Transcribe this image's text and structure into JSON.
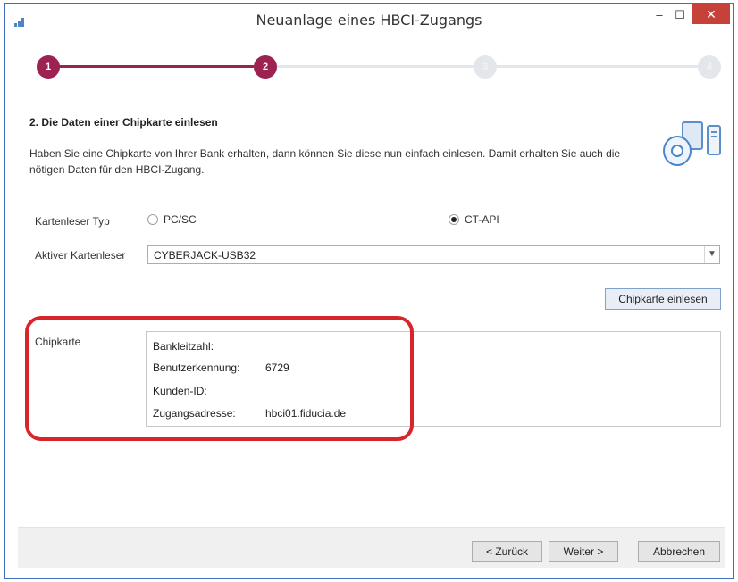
{
  "window": {
    "title": "Neuanlage eines HBCI-Zugangs",
    "minimize_glyph": "–",
    "maximize_glyph": "☐",
    "close_glyph": "✕"
  },
  "steps": [
    {
      "label": "1",
      "state": "done"
    },
    {
      "label": "2",
      "state": "active"
    },
    {
      "label": "3",
      "state": "inactive"
    },
    {
      "label": "4",
      "state": "inactive"
    }
  ],
  "section": {
    "title": "2. Die Daten einer Chipkarte einlesen",
    "description": "Haben Sie eine Chipkarte von Ihrer Bank erhalten, dann können Sie diese nun einfach einlesen. Damit erhalten Sie auch die nötigen Daten für den HBCI-Zugang."
  },
  "reader_type": {
    "label": "Kartenleser Typ",
    "options": [
      {
        "label": "PC/SC",
        "checked": false
      },
      {
        "label": "CT-API",
        "checked": true
      }
    ]
  },
  "active_reader": {
    "label": "Aktiver Kartenleser",
    "value": "CYBERJACK-USB32"
  },
  "read_button": "Chipkarte einlesen",
  "chipcard": {
    "label": "Chipkarte",
    "fields": [
      {
        "key": "Bankleitzahl:",
        "value": ""
      },
      {
        "key": "Benutzerkennung:",
        "value": "6729"
      },
      {
        "key": "Kunden-ID:",
        "value": ""
      },
      {
        "key": "Zugangsadresse:",
        "value": "hbci01.fiducia.de"
      }
    ]
  },
  "footer": {
    "back": "< Zurück",
    "next": "Weiter >",
    "cancel": "Abbrechen"
  },
  "colors": {
    "accent": "#9c2252",
    "inactive_step": "#e3e6eb",
    "close_button": "#c7413b",
    "highlight": "#d7262b",
    "window_border": "#3f6fc0"
  }
}
